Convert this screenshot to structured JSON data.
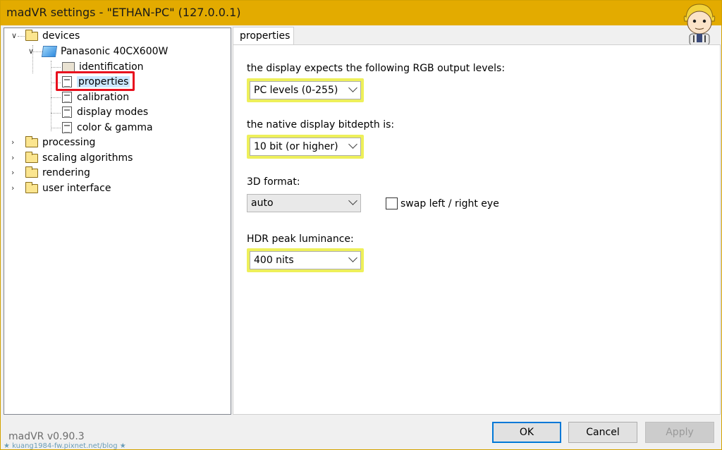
{
  "window": {
    "title": "madVR settings - \"ETHAN-PC\" (127.0.0.1)"
  },
  "tree": {
    "items": [
      {
        "label": "devices",
        "icon": "folder-icon",
        "expander": "expanded"
      },
      {
        "label": "Panasonic 40CX600W",
        "icon": "monitor-icon",
        "expander": "expanded"
      },
      {
        "label": "identification",
        "icon": "id-card-icon"
      },
      {
        "label": "properties",
        "icon": "document-icon",
        "selected": true
      },
      {
        "label": "calibration",
        "icon": "document-icon"
      },
      {
        "label": "display modes",
        "icon": "document-icon"
      },
      {
        "label": "color & gamma",
        "icon": "document-icon"
      },
      {
        "label": "processing",
        "icon": "folder-icon",
        "expander": "collapsed"
      },
      {
        "label": "scaling algorithms",
        "icon": "folder-icon",
        "expander": "collapsed"
      },
      {
        "label": "rendering",
        "icon": "folder-icon",
        "expander": "collapsed"
      },
      {
        "label": "user interface",
        "icon": "folder-icon",
        "expander": "collapsed"
      }
    ]
  },
  "panel": {
    "tab_label": "properties",
    "rgb_levels": {
      "label": "the display expects the following RGB output levels:",
      "value": "PC levels (0-255)"
    },
    "bitdepth": {
      "label": "the native display bitdepth is:",
      "value": "10 bit (or higher)"
    },
    "format3d": {
      "label": "3D format:",
      "value": "auto"
    },
    "swap_eyes": {
      "label": "swap left / right eye",
      "checked": false
    },
    "hdr_peak": {
      "label": "HDR peak luminance:",
      "value": "400 nits"
    }
  },
  "footer": {
    "version": "madVR v0.90.3",
    "watermark": "★ kuang1984-fw.pixnet.net/blog ★",
    "ok_label": "OK",
    "cancel_label": "Cancel",
    "apply_label": "Apply"
  },
  "colors": {
    "titlebar": "#e3ab00",
    "highlight": "#eef05a",
    "selection_box": "#e8101e"
  }
}
